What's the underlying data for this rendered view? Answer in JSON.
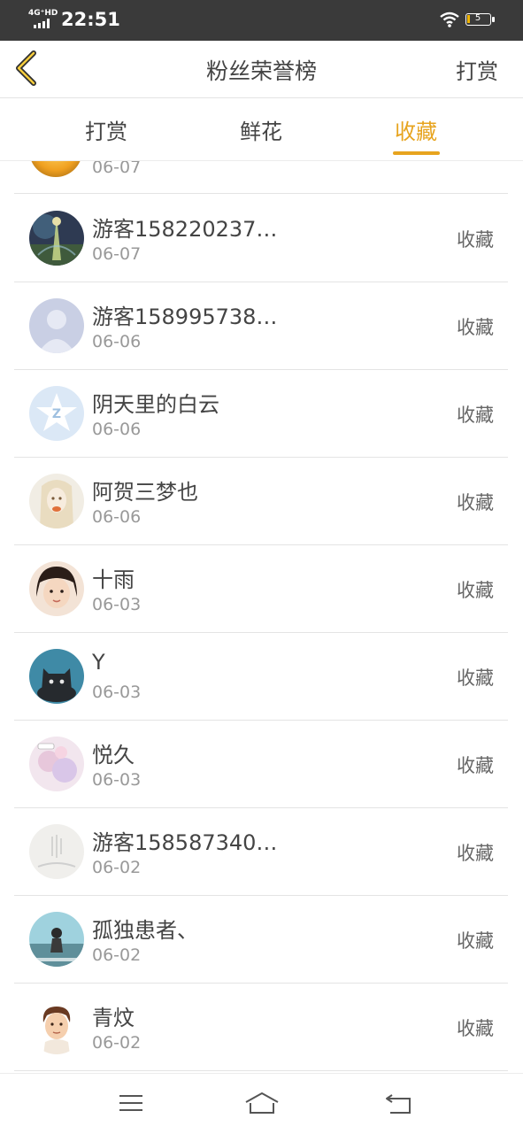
{
  "status_bar": {
    "network": "4G⁺HD",
    "time": "22:51",
    "battery": "5"
  },
  "header": {
    "title": "粉丝荣誉榜",
    "action_label": "打赏"
  },
  "tabs": [
    {
      "label": "打赏",
      "active": false
    },
    {
      "label": "鲜花",
      "active": false
    },
    {
      "label": "收藏",
      "active": true
    }
  ],
  "colors": {
    "accent": "#e7a41f",
    "status_bar": "#3a3a3a",
    "divider": "#e4e4e4"
  },
  "partial_item": {
    "date": "06-07"
  },
  "list": [
    {
      "name": "游客158220237…",
      "date": "06-07",
      "tag": "收藏",
      "avatar": "fantasy-art-avatar"
    },
    {
      "name": "游客158995738…",
      "date": "06-06",
      "tag": "收藏",
      "avatar": "default-user-avatar"
    },
    {
      "name": "阴天里的白云",
      "date": "06-06",
      "tag": "收藏",
      "avatar": "qzone-star-avatar"
    },
    {
      "name": "阿贺三梦也",
      "date": "06-06",
      "tag": "收藏",
      "avatar": "illustrated-girl-avatar"
    },
    {
      "name": "十雨",
      "date": "06-03",
      "tag": "收藏",
      "avatar": "child-photo-avatar"
    },
    {
      "name": "Y",
      "date": "06-03",
      "tag": "收藏",
      "avatar": "black-cat-avatar"
    },
    {
      "name": "悦久",
      "date": "06-03",
      "tag": "收藏",
      "avatar": "pastel-floral-avatar"
    },
    {
      "name": "游客158587340…",
      "date": "06-02",
      "tag": "收藏",
      "avatar": "ink-calligraphy-avatar"
    },
    {
      "name": "孤独患者、",
      "date": "06-02",
      "tag": "收藏",
      "avatar": "seaside-photo-avatar"
    },
    {
      "name": "青炆",
      "date": "06-02",
      "tag": "收藏",
      "avatar": "cartoon-boy-avatar"
    }
  ],
  "nav": {
    "menu": "menu-icon",
    "home": "home-icon",
    "back": "back-icon"
  }
}
